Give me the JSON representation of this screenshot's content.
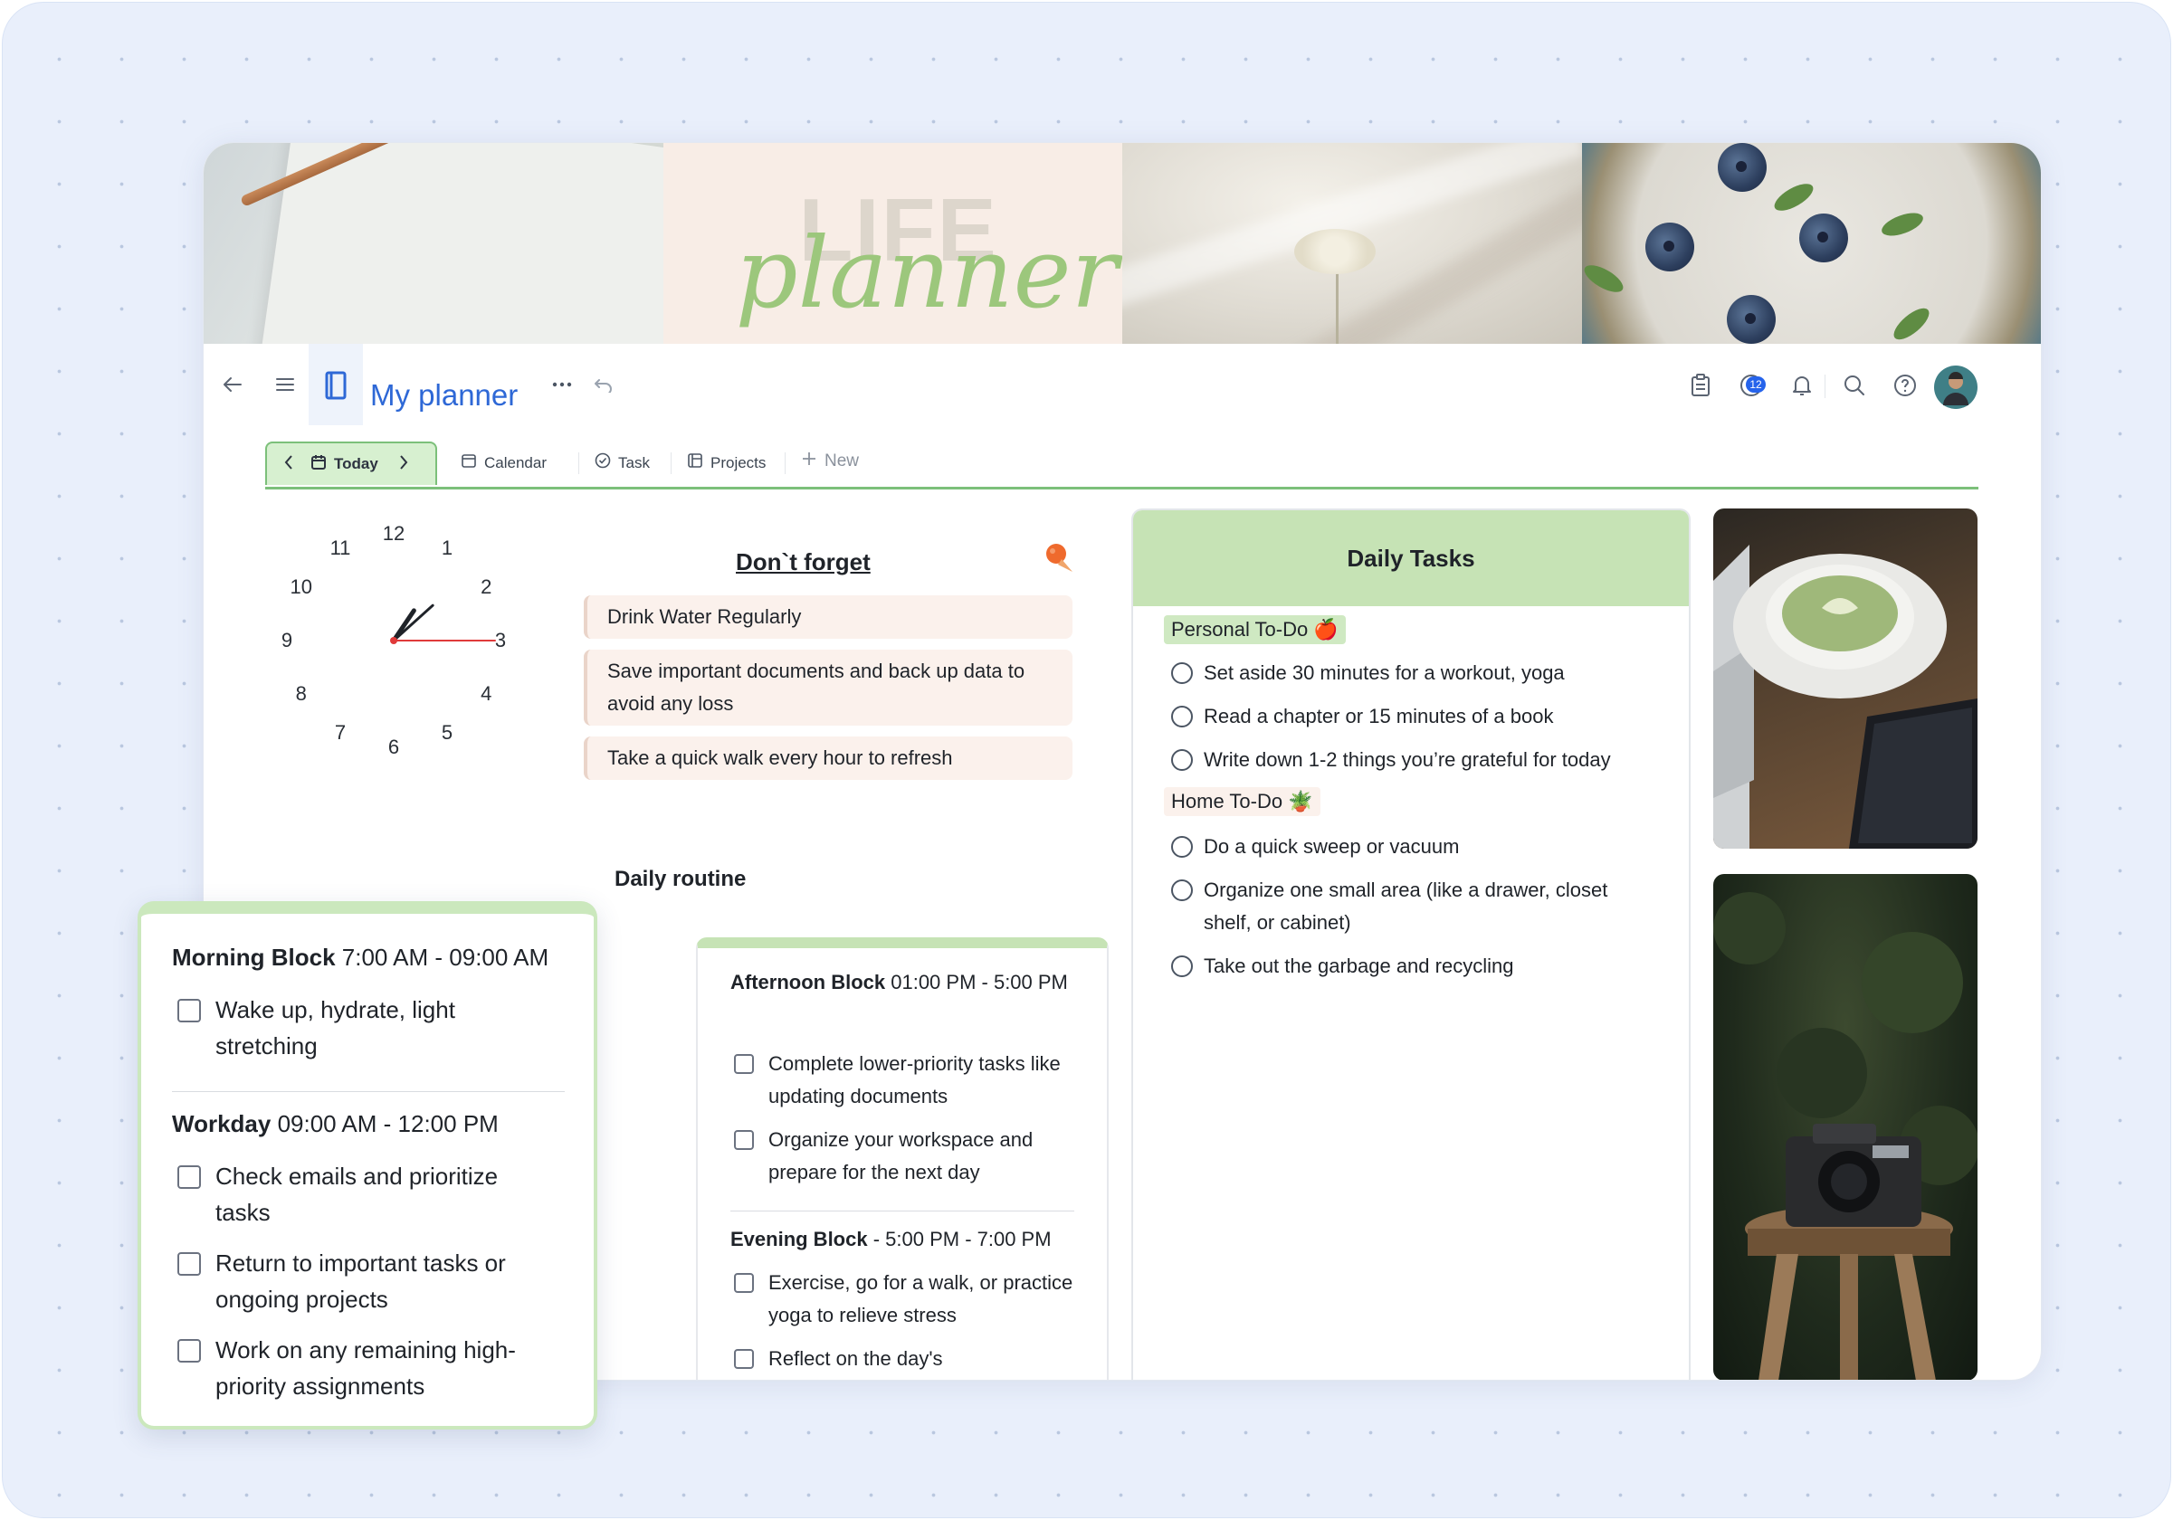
{
  "app": {
    "title": "My planner"
  },
  "header": {
    "notifications_badge": "12"
  },
  "tabs": {
    "today": "Today",
    "calendar": "Calendar",
    "task": "Task",
    "projects": "Projects",
    "new": "New"
  },
  "clock": {
    "numbers": [
      "12",
      "1",
      "2",
      "3",
      "4",
      "5",
      "6",
      "7",
      "8",
      "9",
      "10",
      "11"
    ],
    "time": {
      "hour": 1,
      "minute": 8,
      "second": 15
    }
  },
  "dont_forget": {
    "title": "Don`t forget ",
    "items": [
      "Drink Water Regularly",
      "Save important documents and back up data to avoid any loss",
      "Take a quick walk every hour to refresh"
    ]
  },
  "daily_routine": {
    "title": "Daily routine",
    "morning": {
      "label": "Morning Block",
      "time": " 7:00 AM - 09:00 AM",
      "tasks": [
        "Wake up, hydrate, light stretching"
      ]
    },
    "workday": {
      "label": "Workday",
      "time": "  09:00 AM - 12:00 PM",
      "tasks": [
        "Check emails and prioritize tasks",
        "Return to important tasks or ongoing projects",
        "Work on any remaining high-priority assignments"
      ]
    },
    "afternoon": {
      "label": "Afternoon Block",
      "time": " 01:00 PM - 5:00 PM",
      "tasks": [
        "Complete lower-priority tasks like updating documents",
        "Organize your workspace and prepare for the next day"
      ]
    },
    "evening": {
      "label": "Evening Block",
      "time": " - 5:00 PM - 7:00 PM",
      "tasks": [
        "Exercise, go for a walk, or practice yoga to relieve stress",
        "Reflect on the day's"
      ]
    }
  },
  "daily_tasks": {
    "title": "Daily Tasks",
    "personal": {
      "label": "Personal To-Do 🍎",
      "items": [
        "Set aside 30 minutes for a workout, yoga",
        "Read a chapter or 15 minutes of a book",
        "Write down 1-2 things you’re grateful for today"
      ]
    },
    "home": {
      "label": "Home To-Do 🪴",
      "items": [
        "Do a quick sweep or vacuum",
        "Organize one small area (like a drawer, closet shelf, or cabinet)",
        "Take out the garbage and recycling"
      ]
    }
  },
  "colors": {
    "accent_green": "#7cc07a",
    "header_green": "#c6e3b5",
    "title_blue": "#2e68d6",
    "note_bg": "#fbf1ec"
  },
  "icons": {
    "back": "arrow-left-icon",
    "menu": "hamburger-icon",
    "notebook": "notebook-icon",
    "more": "more-horizontal-icon",
    "undo": "undo-icon",
    "calendar_clip": "clipboard-icon",
    "tasks": "check-circle-icon",
    "bell": "bell-icon",
    "search": "search-icon",
    "help": "help-icon"
  }
}
